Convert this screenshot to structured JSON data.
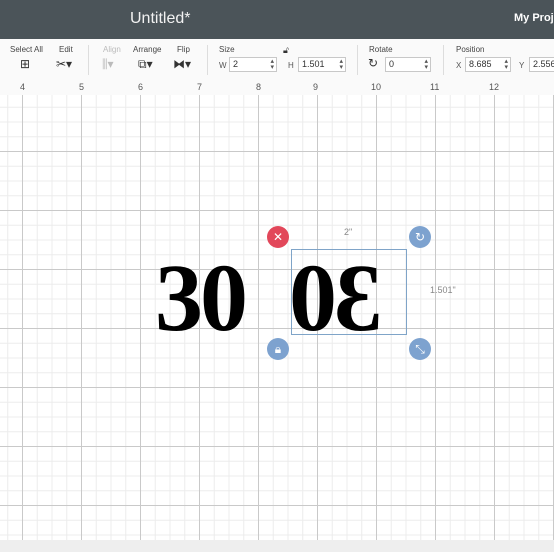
{
  "header": {
    "title": "Untitled*",
    "project_link": "My Projects"
  },
  "toolbar": {
    "select_all": "Select All",
    "edit": "Edit",
    "align": "Align",
    "arrange": "Arrange",
    "flip": "Flip",
    "size": "Size",
    "rotate": "Rotate",
    "position": "Position",
    "width_label": "W",
    "width_value": "2",
    "height_label": "H",
    "height_value": "1.501",
    "rotate_value": "0",
    "x_label": "X",
    "x_value": "8.685",
    "y_label": "Y",
    "y_value": "2.556"
  },
  "ruler": {
    "ticks": [
      "4",
      "5",
      "6",
      "7",
      "8",
      "9",
      "10",
      "11",
      "12"
    ]
  },
  "canvas": {
    "text_normal": "30",
    "text_mirrored": "30",
    "width_dimension": "2\"",
    "height_dimension": "1.501\""
  },
  "colors": {
    "topbar": "#4b5459",
    "delete_handle": "#e2475a",
    "handle_blue": "#7da2cf"
  },
  "icons": {
    "select_all": "select-all-icon",
    "edit": "edit-icon",
    "align": "align-icon",
    "arrange": "arrange-icon",
    "flip": "flip-icon",
    "lock_ratio": "lock-icon",
    "rotate": "rotate-icon",
    "delete": "close-icon",
    "lock": "lock-icon",
    "resize": "resize-icon"
  }
}
